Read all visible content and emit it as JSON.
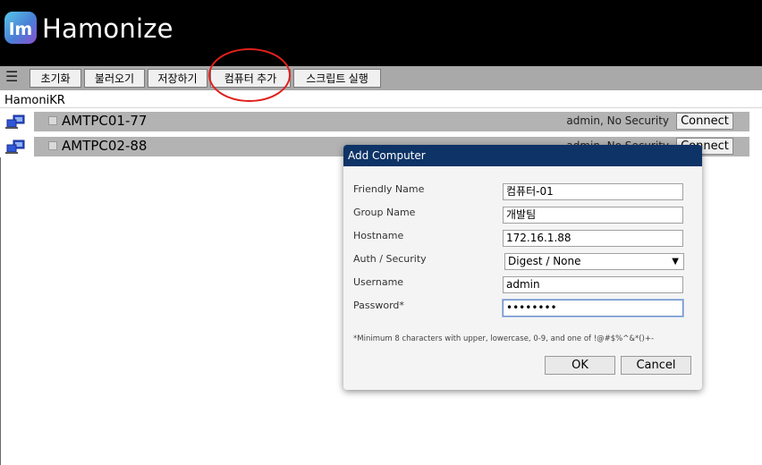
{
  "app": {
    "title": "Hamonize"
  },
  "toolbar": {
    "menu_icon": "hamburger-menu-icon",
    "buttons": [
      "초기화",
      "불러오기",
      "저장하기",
      "컴퓨터 추가",
      "스크립트 실행"
    ],
    "highlight_color": "#e0201b"
  },
  "group": {
    "name": "HamoniKR"
  },
  "computers": [
    {
      "name": "AMTPC01-77",
      "status": "admin, No Security",
      "action": "Connect"
    },
    {
      "name": "AMTPC02-88",
      "status": "admin, No Security",
      "action": "Connect"
    }
  ],
  "dialog": {
    "title": "Add Computer",
    "fields": {
      "friendly_name": {
        "label": "Friendly Name",
        "value": "컴퓨터-01"
      },
      "group_name": {
        "label": "Group Name",
        "value": "개발팀"
      },
      "hostname": {
        "label": "Hostname",
        "value": "172.16.1.88"
      },
      "auth_security": {
        "label": "Auth / Security",
        "value": "Digest / None"
      },
      "username": {
        "label": "Username",
        "value": "admin"
      },
      "password": {
        "label": "Password*",
        "value": "••••••••"
      }
    },
    "hint": "*Minimum 8 characters with upper, lowercase, 0-9, and one of !@#$%^&*()+-",
    "ok_label": "OK",
    "cancel_label": "Cancel",
    "title_bar_color": "#0e3366"
  }
}
